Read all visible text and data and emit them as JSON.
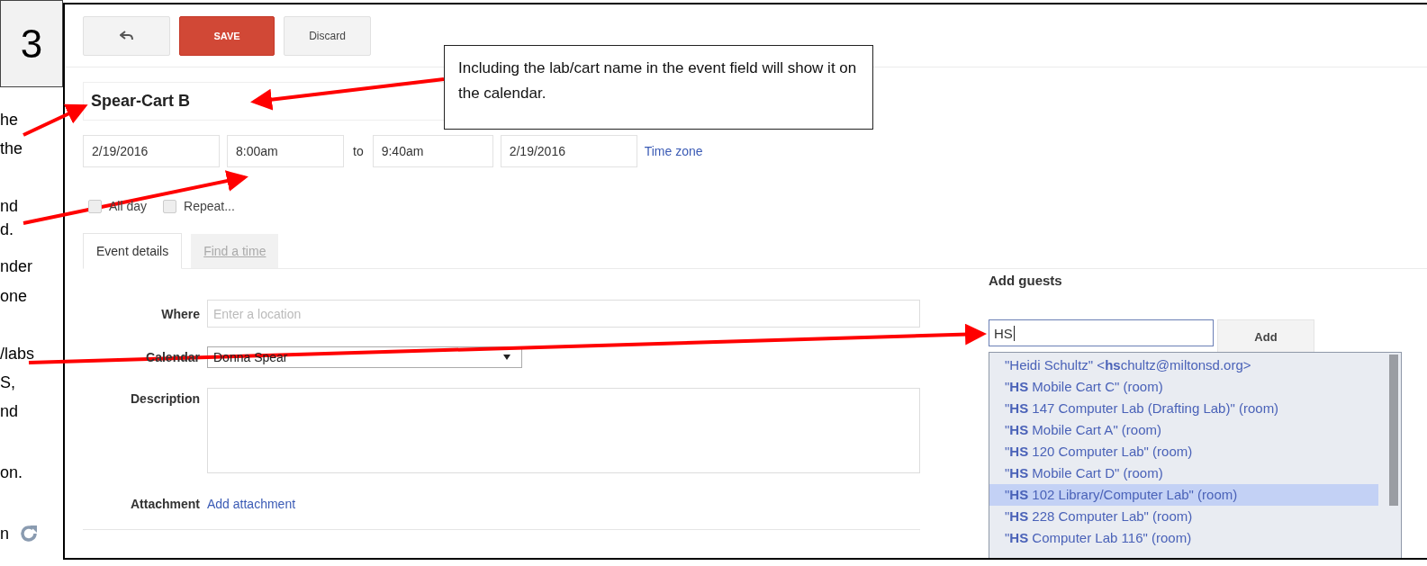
{
  "slide": {
    "number": "3",
    "text_fragments": [
      "he",
      "the",
      "nd",
      "d.",
      "nder",
      "one",
      "/labs",
      "S,",
      "nd",
      "on.",
      "n"
    ]
  },
  "callout": {
    "text": "Including the lab/cart name in the event field will show it on the calendar."
  },
  "toolbar": {
    "buttons": [
      {
        "kind": "back"
      },
      {
        "kind": "primary",
        "label": "SAVE"
      },
      {
        "kind": "default",
        "label": "Discard"
      }
    ]
  },
  "event": {
    "title": "Spear-Cart B",
    "start_date": "2/19/2016",
    "start_time": "8:00am",
    "to_label": "to",
    "end_time": "9:40am",
    "end_date": "2/19/2016",
    "time_zone_link": "Time zone"
  },
  "options": [
    {
      "label": "All day",
      "checked": false
    },
    {
      "label": "Repeat...",
      "checked": false
    }
  ],
  "tabs": [
    {
      "label": "Event details",
      "selected": true
    },
    {
      "label": "Find a time",
      "selected": false
    }
  ],
  "form": {
    "where": {
      "label": "Where",
      "placeholder": "Enter a location"
    },
    "calendar": {
      "label": "Calendar",
      "value": "Donna Spear"
    },
    "description": {
      "label": "Description"
    },
    "attachment": {
      "label": "Attachment",
      "link": "Add attachment"
    }
  },
  "guests": {
    "label": "Add guests",
    "value": "HS",
    "add_button": "Add",
    "suggestions": [
      {
        "text": "\"Heidi Schultz\" <**hs**chultz@miltonsd.org>",
        "selected": false
      },
      {
        "text": "\"**HS** Mobile Cart C\" (room)",
        "selected": false
      },
      {
        "text": "\"**HS** 147 Computer Lab (Drafting Lab)\" (room)",
        "selected": false
      },
      {
        "text": "\"**HS** Mobile Cart A\" (room)",
        "selected": false
      },
      {
        "text": "\"**HS** 120 Computer Lab\" (room)",
        "selected": false
      },
      {
        "text": "\"**HS** Mobile Cart D\" (room)",
        "selected": false
      },
      {
        "text": "\"**HS** 102 Library/Computer Lab\" (room)",
        "selected": true
      },
      {
        "text": "\"**HS** 228 Computer Lab\" (room)",
        "selected": false
      },
      {
        "text": "\"**HS** Computer Lab 116\" (room)",
        "selected": false
      }
    ]
  }
}
